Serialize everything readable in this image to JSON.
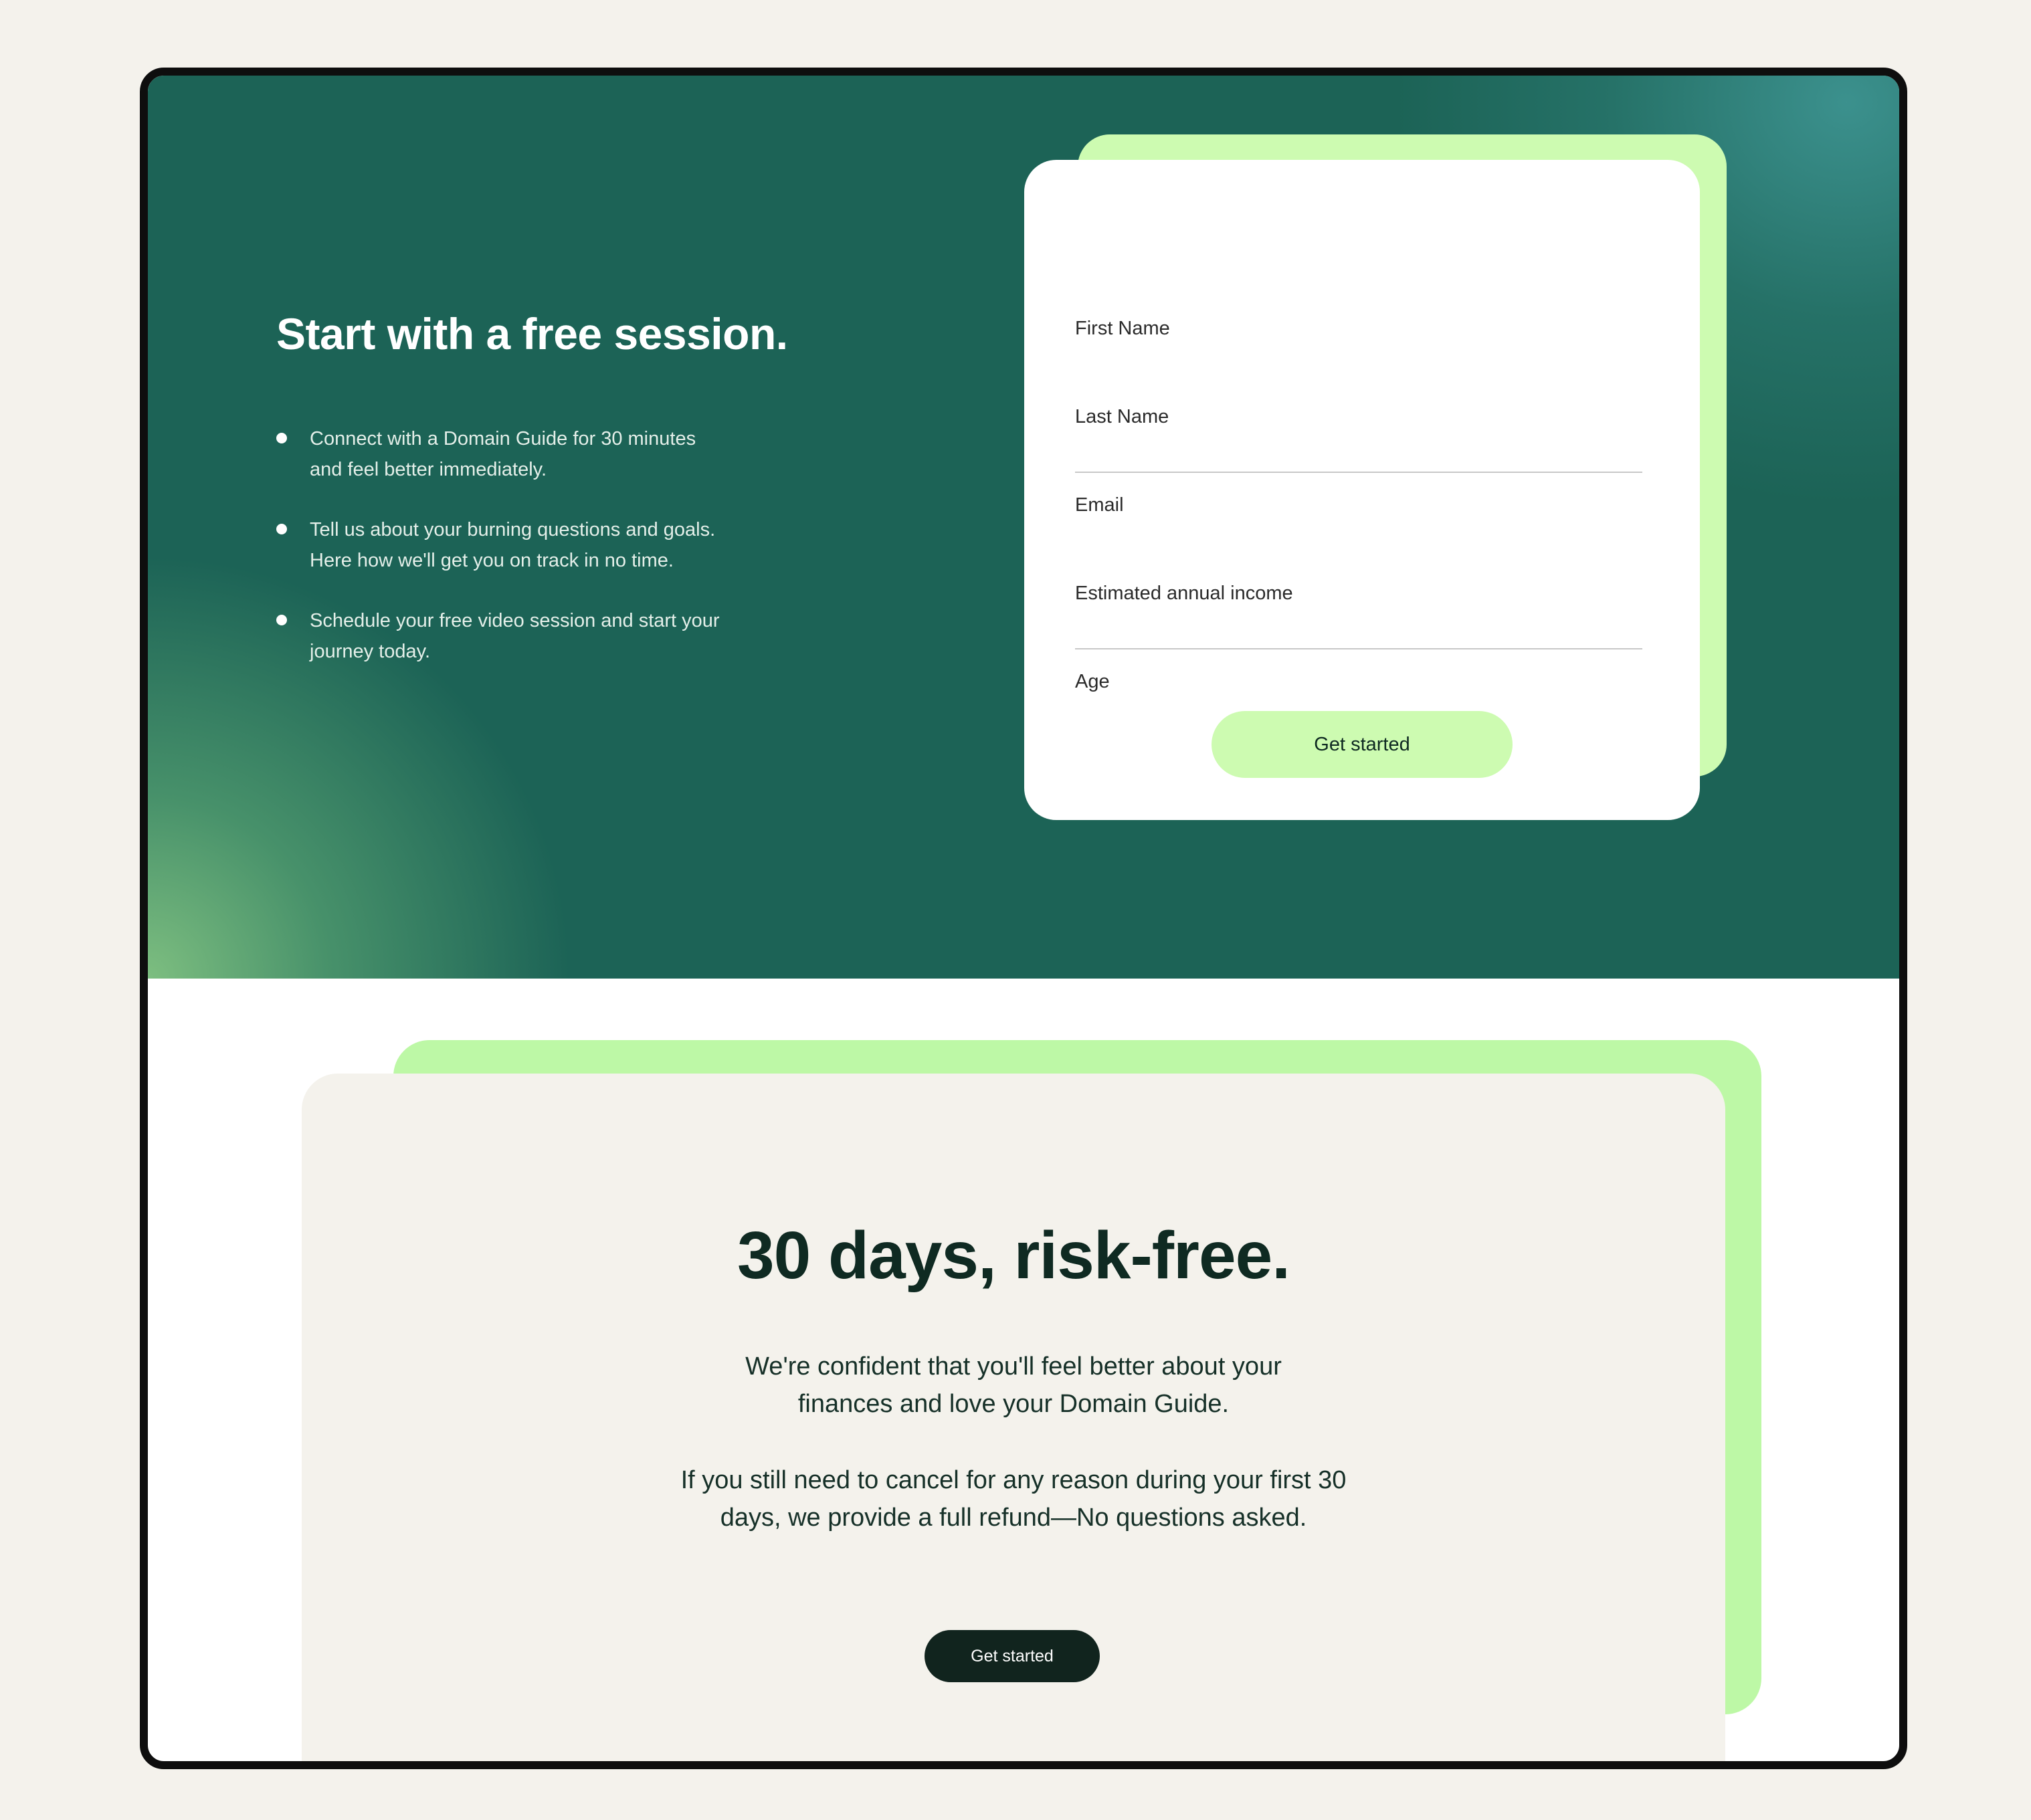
{
  "hero": {
    "title": "Start with a free session.",
    "bullets": [
      {
        "line1": "Connect with a Domain Guide for 30 minutes",
        "line2": "and feel better immediately."
      },
      {
        "line1": "Tell us about your burning questions and goals.",
        "line2": "Here how we'll get you on track in no time."
      },
      {
        "line1": "Schedule your free video session and start your",
        "line2": "journey today."
      }
    ]
  },
  "form": {
    "fields": [
      {
        "label": "First Name"
      },
      {
        "label": "Last Name"
      },
      {
        "label": "Email"
      },
      {
        "label": "Estimated annual income"
      },
      {
        "label": "Age"
      }
    ],
    "submit_label": "Get started"
  },
  "promo": {
    "title": "30 days, risk-free.",
    "paragraph1": {
      "line1": "We're confident that you'll feel better about your",
      "line2": "finances and love your Domain Guide."
    },
    "paragraph2": {
      "line1": "If you still need to cancel for any reason during your first 30",
      "line2": "days, we provide a full refund—No questions asked."
    },
    "cta_label": "Get started"
  },
  "colors": {
    "page_background": "#f4f2ec",
    "hero_green": "#1c6356",
    "accent_lime": "#cdfbb1",
    "dark_text": "#0f2a22",
    "dark_button": "#11241e"
  }
}
